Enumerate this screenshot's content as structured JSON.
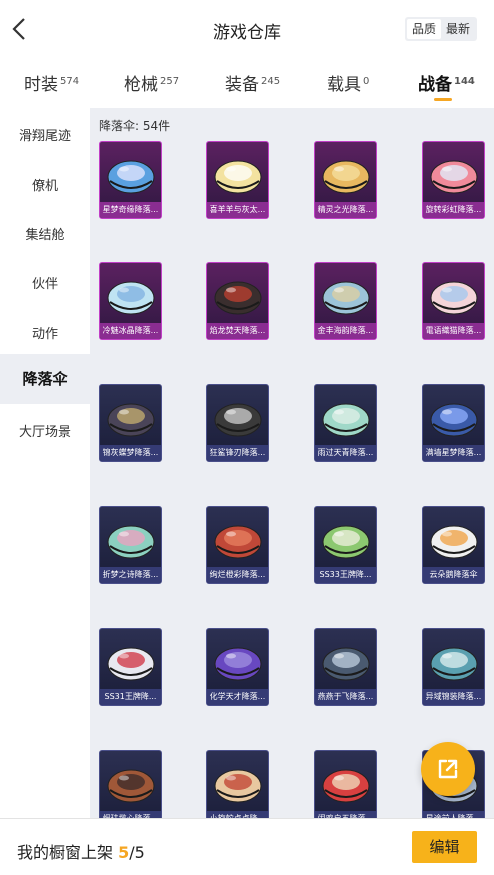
{
  "header": {
    "title": "游戏仓库",
    "sort_options": [
      "品质",
      "最新"
    ],
    "sort_selected": "品质"
  },
  "tabs": [
    {
      "label": "时装",
      "count": "574"
    },
    {
      "label": "枪械",
      "count": "257"
    },
    {
      "label": "装备",
      "count": "245"
    },
    {
      "label": "载具",
      "count": "0"
    },
    {
      "label": "战备",
      "count": "144",
      "active": true
    }
  ],
  "sidebar": {
    "items": [
      {
        "label": "滑翔尾迹"
      },
      {
        "label": "僚机"
      },
      {
        "label": "集结舱"
      },
      {
        "label": "伙伴"
      },
      {
        "label": "动作"
      },
      {
        "label": "降落伞",
        "active": true
      },
      {
        "label": "大厅场景"
      }
    ]
  },
  "content": {
    "count_label": "降落伞: 54件",
    "items": [
      {
        "name": "星梦奇缘降落...",
        "rarity": "purple",
        "color": "#5aa0e0",
        "accent": "#e8e8ff"
      },
      {
        "name": "喜羊羊与灰太...",
        "rarity": "purple",
        "color": "#f3e2a0",
        "accent": "#ffffff"
      },
      {
        "name": "精灵之光降落...",
        "rarity": "purple",
        "color": "#e8b860",
        "accent": "#f6e0a0"
      },
      {
        "name": "旋转彩虹降落...",
        "rarity": "purple",
        "color": "#f08a9a",
        "accent": "#e0f0ff"
      },
      {
        "name": "冷魅冰晶降落...",
        "rarity": "purple",
        "color": "#bfe3f2",
        "accent": "#7fb0e0"
      },
      {
        "name": "焰龙焚天降落...",
        "rarity": "purple",
        "color": "#3a2e2e",
        "accent": "#c04030"
      },
      {
        "name": "金丰海韵降落...",
        "rarity": "purple",
        "color": "#9cc4d8",
        "accent": "#e0d0a0"
      },
      {
        "name": "電语織猫降落...",
        "rarity": "purple",
        "color": "#f4d4d8",
        "accent": "#a0c8f0"
      },
      {
        "name": "锦灰蝶梦降落...",
        "rarity": "blue",
        "color": "#4a4458",
        "accent": "#c8b070"
      },
      {
        "name": "狂鲨锋刃降落...",
        "rarity": "blue",
        "color": "#3a3a3a",
        "accent": "#d0d0d0"
      },
      {
        "name": "雨过天青降落...",
        "rarity": "blue",
        "color": "#9fd8c8",
        "accent": "#e0f0e8"
      },
      {
        "name": "满墙星梦降落...",
        "rarity": "blue",
        "color": "#3a5aa8",
        "accent": "#90b0ff"
      },
      {
        "name": "折梦之诗降落...",
        "rarity": "blue",
        "color": "#8cd0c0",
        "accent": "#f0a0c0"
      },
      {
        "name": "绚烂橙彩降落...",
        "rarity": "blue",
        "color": "#c04838",
        "accent": "#e88060"
      },
      {
        "name": "SS33王牌降...",
        "rarity": "blue",
        "color": "#8cc870",
        "accent": "#f0f0e0"
      },
      {
        "name": "云朵鹅降落伞",
        "rarity": "blue",
        "color": "#f0f0f0",
        "accent": "#f0a040"
      },
      {
        "name": "SS31王牌降...",
        "rarity": "blue",
        "color": "#e8e8f0",
        "accent": "#d03040"
      },
      {
        "name": "化学天才降落...",
        "rarity": "blue",
        "color": "#6848c0",
        "accent": "#a090e0"
      },
      {
        "name": "燕燕于飞降落...",
        "rarity": "blue",
        "color": "#4a5a70",
        "accent": "#c0d0e0"
      },
      {
        "name": "异域锦装降落...",
        "rarity": "blue",
        "color": "#5aa0b0",
        "accent": "#e0f0f0"
      },
      {
        "name": "烟珐揽心降落...",
        "rarity": "blue",
        "color": "#a05838",
        "accent": "#3a2a2a"
      },
      {
        "name": "小旋蛇点点降...",
        "rarity": "blue",
        "color": "#e8c8a0",
        "accent": "#c04030"
      },
      {
        "name": "闹鸡启五降落...",
        "rarity": "blue",
        "color": "#d84040",
        "accent": "#f0e0c0"
      },
      {
        "name": "星途前人降落...",
        "rarity": "blue",
        "color": "#a8b8d0",
        "accent": "#f0f0f0"
      }
    ]
  },
  "footer": {
    "text": "我的橱窗上架",
    "shown": "5",
    "separator": "/",
    "total": "5",
    "edit_label": "编辑"
  },
  "colors": {
    "accent": "#f7b21a",
    "panel": "#eceef3",
    "purple_border": "#c13fc7",
    "blue_border": "#4a4f8a"
  }
}
